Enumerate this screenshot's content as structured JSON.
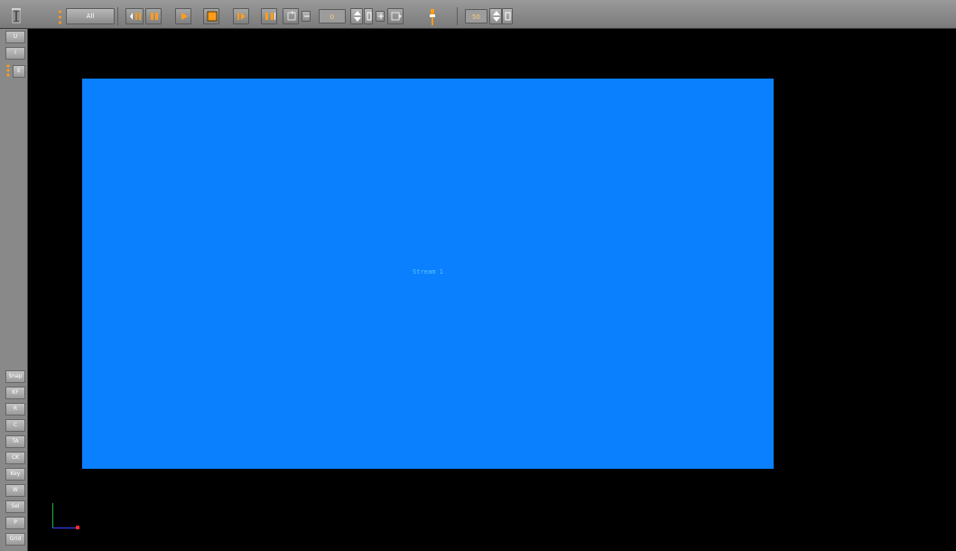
{
  "toolbar": {
    "mode_label": "All",
    "frame_value": "0",
    "speed_value": "50"
  },
  "sidebar": {
    "top_items": [
      {
        "label": "U"
      },
      {
        "label": "I"
      },
      {
        "label": "E"
      }
    ],
    "bottom_items": [
      {
        "label": "Snap"
      },
      {
        "label": "KF"
      },
      {
        "label": "R"
      },
      {
        "label": "C"
      },
      {
        "label": "TA"
      },
      {
        "label": "CK"
      },
      {
        "label": "Key"
      },
      {
        "label": "W"
      },
      {
        "label": "Sel"
      },
      {
        "label": "P"
      },
      {
        "label": "Grid"
      }
    ]
  },
  "viewport": {
    "stream_label": "Stream 1",
    "stream_color": "#0a80ff"
  }
}
